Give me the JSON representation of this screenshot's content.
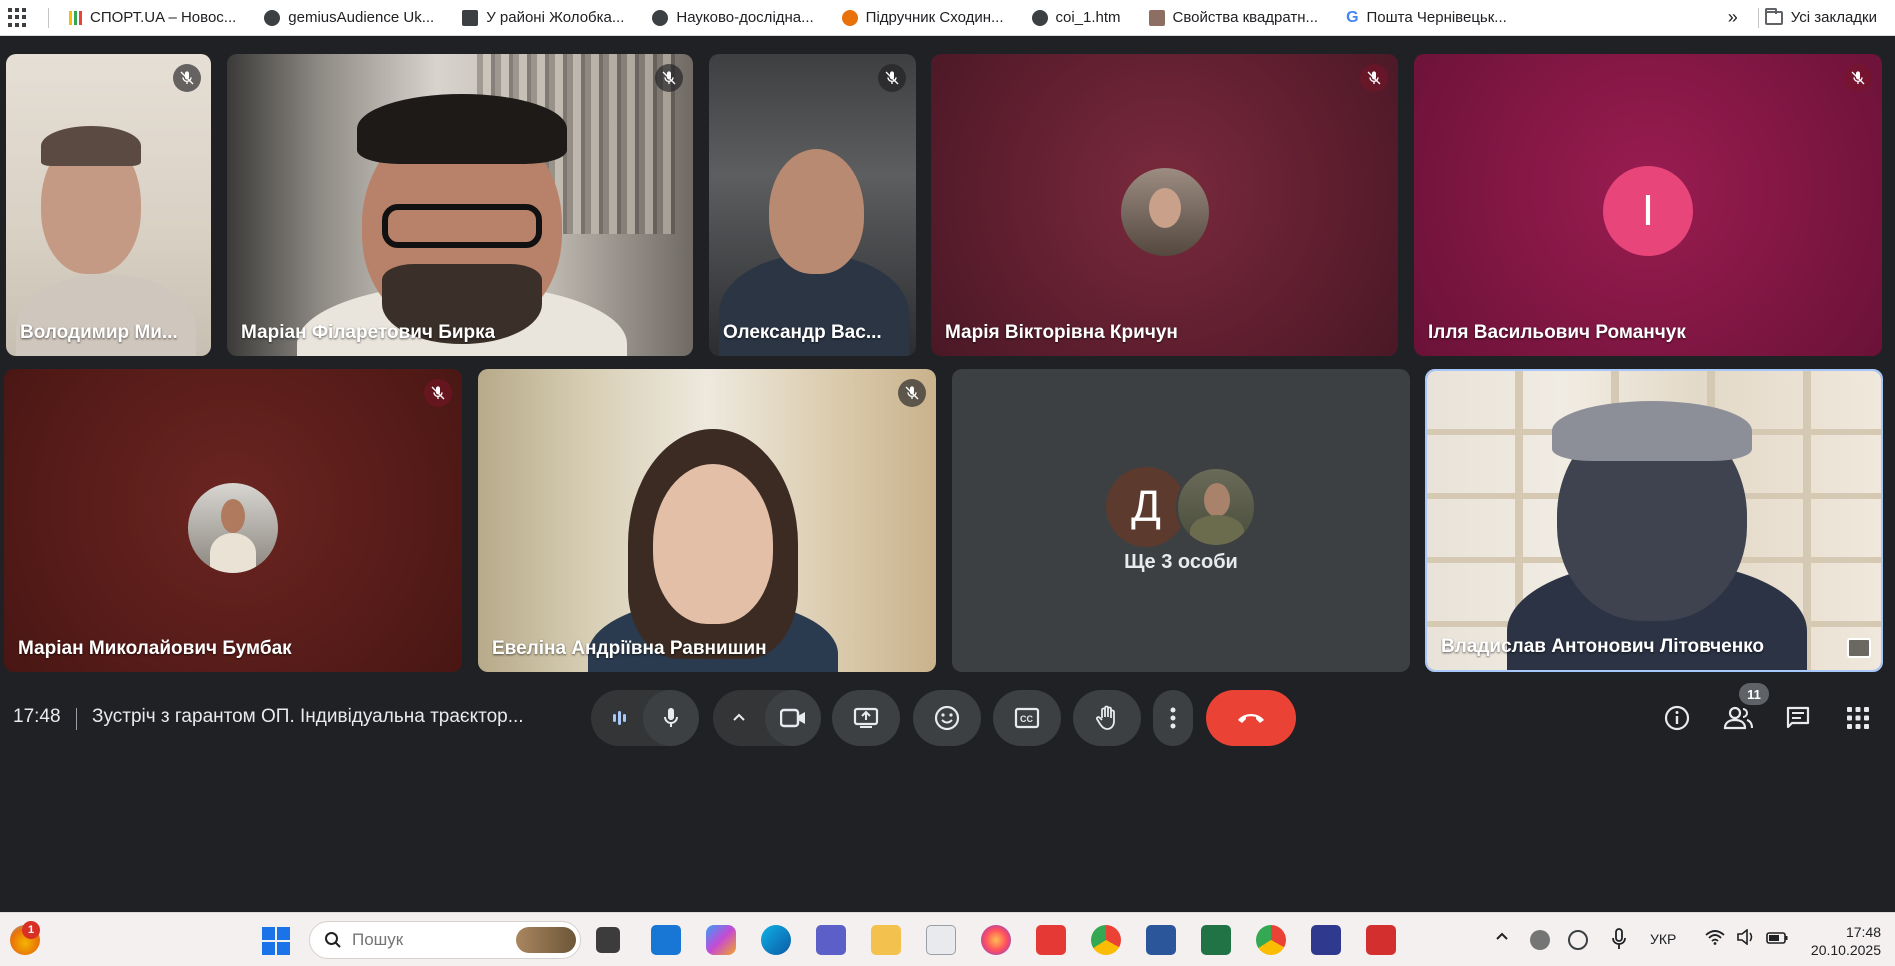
{
  "bookmarks": {
    "items": [
      {
        "label": "СПОРТ.UA – Новос...",
        "icon": "sport-ua-icon",
        "color": "#1a73e8"
      },
      {
        "label": "gemiusAudience Uk...",
        "icon": "globe-icon",
        "color": "#3c4043"
      },
      {
        "label": "У районі Жолобка...",
        "icon": "document-icon",
        "color": "#3c4043"
      },
      {
        "label": "Науково-дослідна...",
        "icon": "globe-icon",
        "color": "#3c4043"
      },
      {
        "label": "Підручник Сходин...",
        "icon": "site-icon",
        "color": "#e8710a"
      },
      {
        "label": "coi_1.htm",
        "icon": "globe-icon",
        "color": "#3c4043"
      },
      {
        "label": "Свойства квадратн...",
        "icon": "site-icon",
        "color": "#8d6e63"
      },
      {
        "label": "Пошта Чернівецьк...",
        "icon": "google-icon",
        "color": "#4285f4"
      }
    ],
    "more": "»",
    "all_bookmarks": "Усі закладки"
  },
  "tiles": [
    {
      "name": "Володимир Ми...",
      "type": "video",
      "muted": true
    },
    {
      "name": "Маріан Філаретович Бирка",
      "type": "video",
      "muted": true
    },
    {
      "name": "Олександр Вас...",
      "type": "video",
      "muted": true
    },
    {
      "name": "Марія Вікторівна Кричун",
      "type": "avatar",
      "muted": true,
      "bg": "#6e1f33"
    },
    {
      "name": "Ілля Васильович Романчук",
      "type": "initial",
      "initial": "І",
      "muted": true,
      "bg": "#8a1846",
      "avatar_color": "#e8457a"
    },
    {
      "name": "Маріан Миколайович Бумбак",
      "type": "avatar",
      "muted": true,
      "bg": "#5e1c18"
    },
    {
      "name": "Евеліна Андріївна Равнишин",
      "type": "video",
      "muted": true
    },
    {
      "name": "Ще 3 особи",
      "type": "group",
      "initial": "Д",
      "avatar_color": "#5d3a2e"
    },
    {
      "name": "Владислав Антонович Літовченко",
      "type": "video",
      "muted": false,
      "active": true
    }
  ],
  "meeting": {
    "time": "17:48",
    "title": "Зустріч з гарантом ОП. Індивідуальна траєктор...",
    "participants_count": "11"
  },
  "taskbar": {
    "search_placeholder": "Пошук",
    "widgets_badge": "1",
    "language": "УКР",
    "time": "17:48",
    "date": "20.10.2025"
  }
}
